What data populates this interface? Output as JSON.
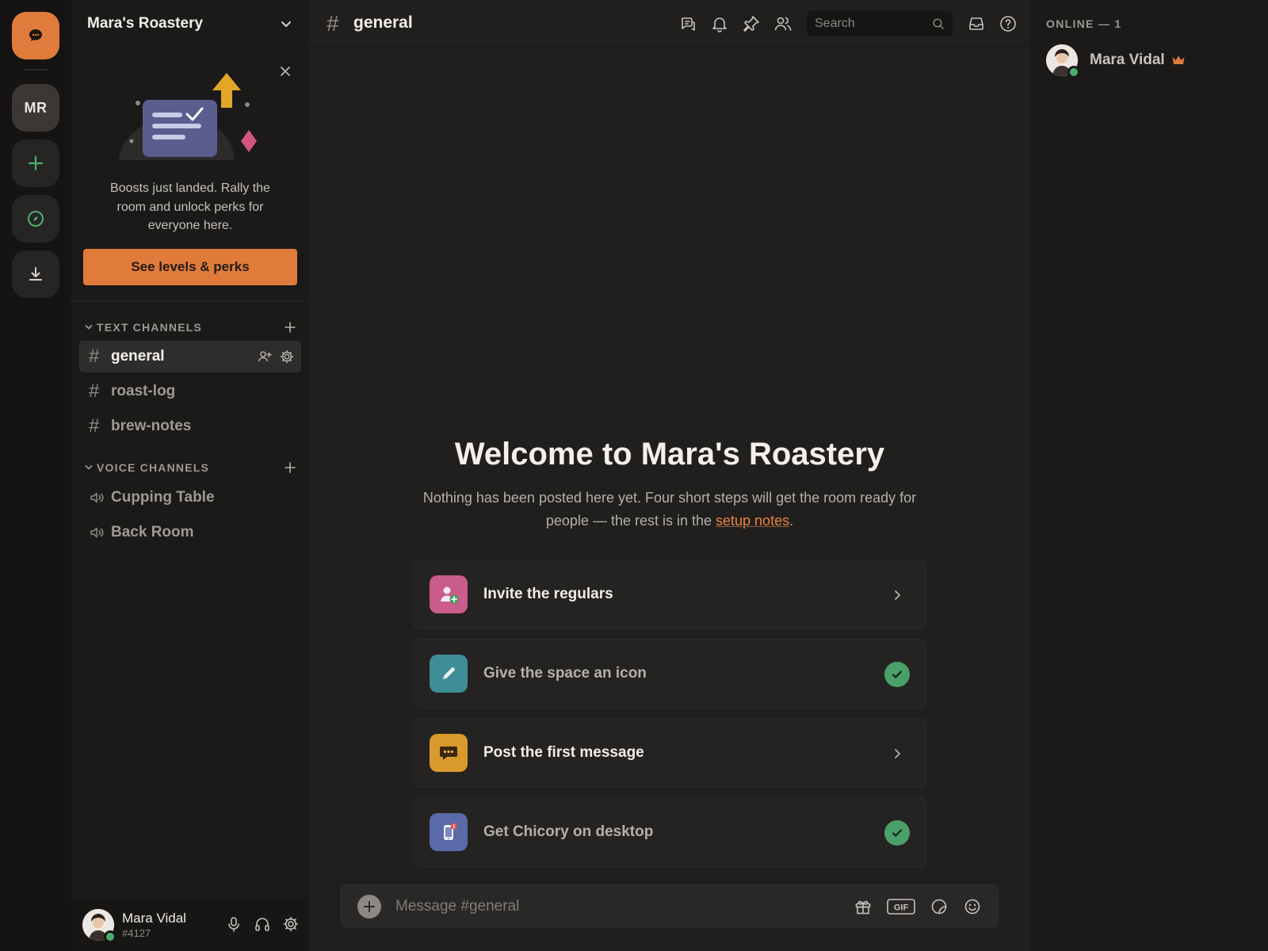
{
  "rail": {
    "home_icon": "chat-bubble-icon",
    "server_initials": "MR",
    "add_icon": "plus-icon",
    "explore_icon": "compass-icon",
    "download_icon": "download-icon"
  },
  "server": {
    "name": "Mara's Roastery"
  },
  "boost": {
    "text": "Boosts just landed. Rally the room and unlock perks for everyone here.",
    "button": "See levels & perks"
  },
  "text_channels": {
    "label": "TEXT CHANNELS",
    "items": [
      {
        "name": "general",
        "active": true
      },
      {
        "name": "roast-log",
        "active": false
      },
      {
        "name": "brew-notes",
        "active": false
      }
    ]
  },
  "voice_channels": {
    "label": "VOICE CHANNELS",
    "items": [
      {
        "name": "Cupping Table"
      },
      {
        "name": "Back Room"
      }
    ]
  },
  "user": {
    "name": "Mara Vidal",
    "tag": "#4127"
  },
  "topbar": {
    "channel": "general",
    "search_placeholder": "Search"
  },
  "welcome": {
    "title": "Welcome to Mara's Roastery",
    "subtitle_before": "Nothing has been posted here yet. Four short steps will get the room ready for people — the rest is in the ",
    "subtitle_link": "setup notes",
    "subtitle_after": "."
  },
  "steps": [
    {
      "label": "Invite the regulars",
      "done": false,
      "color": "#c95c8a"
    },
    {
      "label": "Give the space an icon",
      "done": true,
      "color": "#3f8d96"
    },
    {
      "label": "Post the first message",
      "done": false,
      "color": "#d99a2b"
    },
    {
      "label": "Get Chicory on desktop",
      "done": true,
      "color": "#5a6aa8"
    }
  ],
  "composer": {
    "placeholder": "Message #general",
    "gif_label": "GIF"
  },
  "members": {
    "header": "ONLINE — 1",
    "list": [
      {
        "name": "Mara Vidal",
        "owner": true
      }
    ]
  },
  "colors": {
    "accent": "#e07b3c",
    "online": "#4caf6e",
    "check": "#4b9f68"
  }
}
